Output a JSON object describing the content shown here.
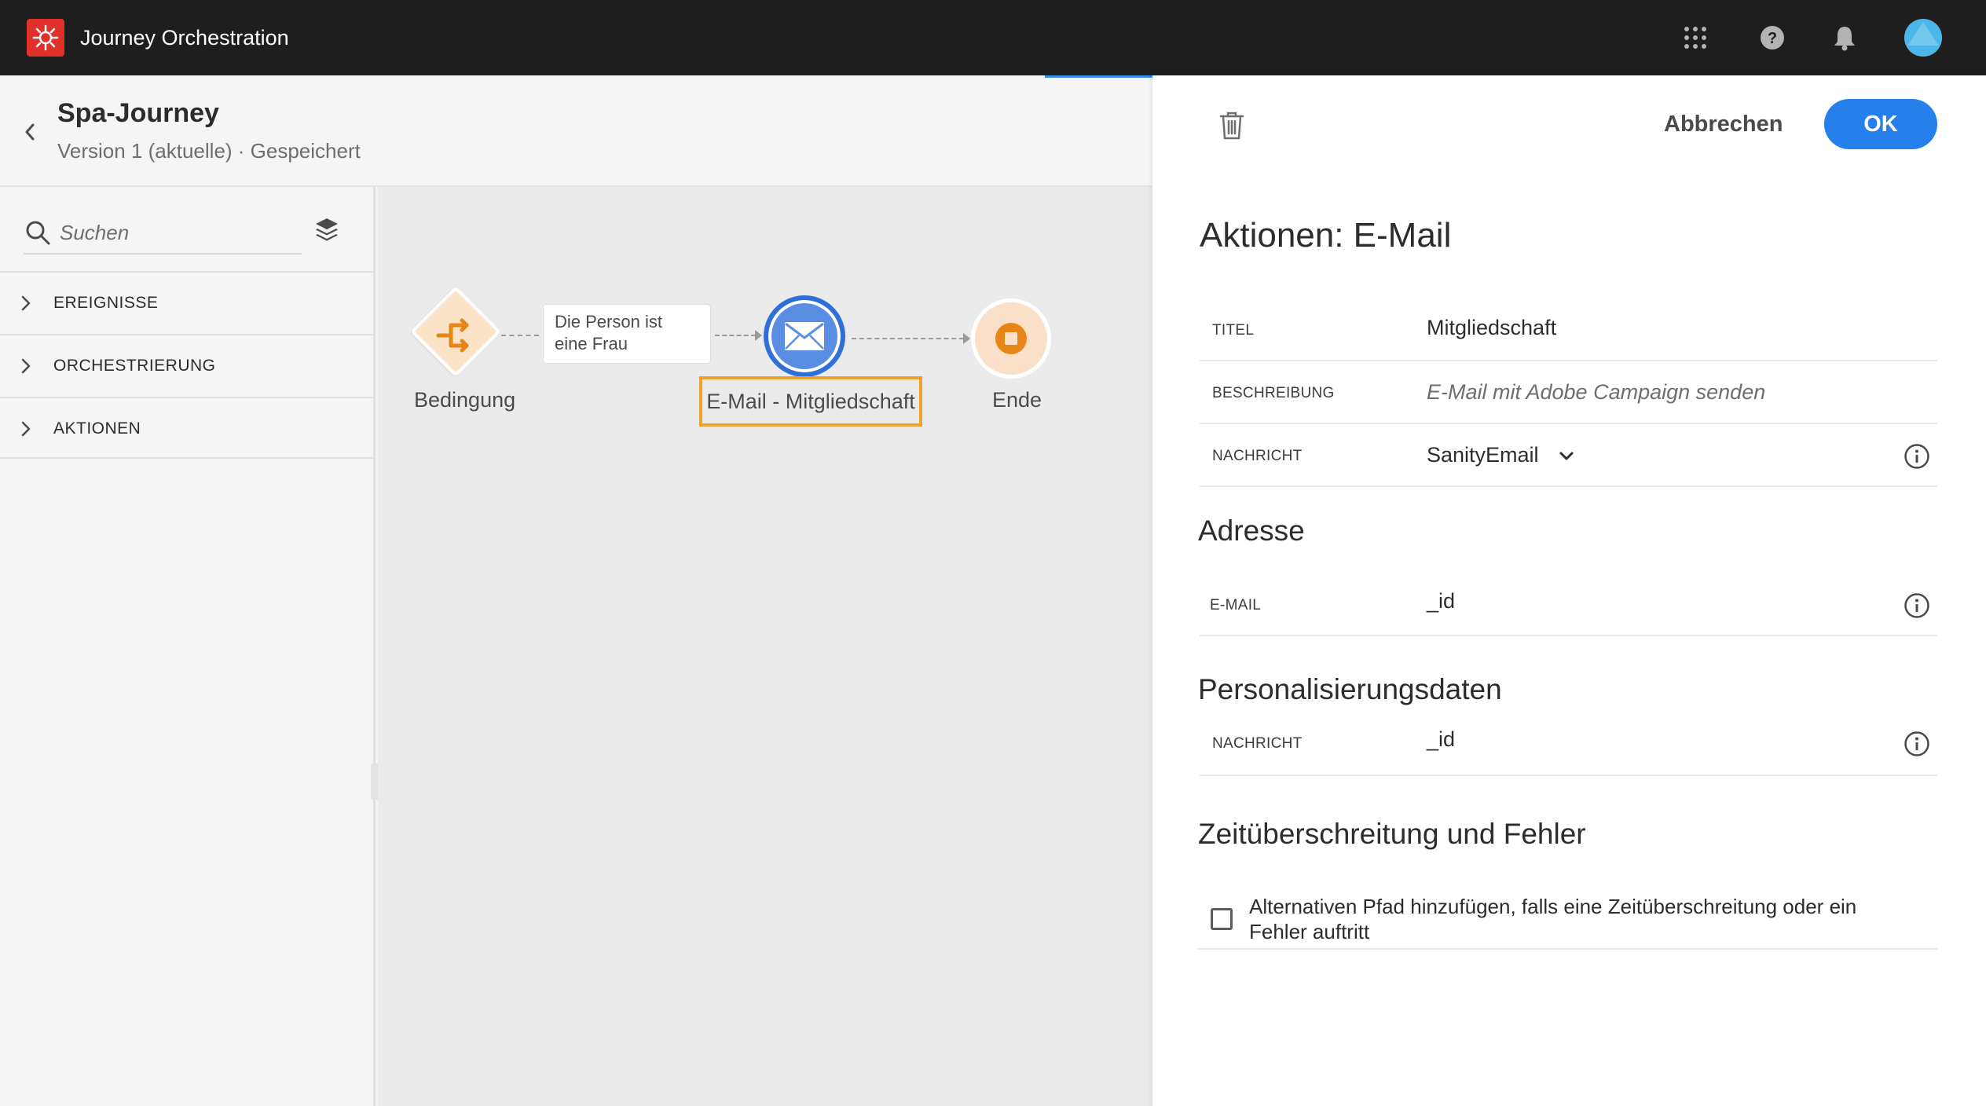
{
  "app": {
    "title": "Journey Orchestration"
  },
  "topbar_icons": [
    "apps-grid-icon",
    "help-icon",
    "bell-icon",
    "avatar"
  ],
  "journey": {
    "name": "Spa-Journey",
    "version": "Version 1 (aktuelle) · Gespeichert"
  },
  "sidebar": {
    "search_placeholder": "Suchen",
    "sections": [
      {
        "label": "EREIGNISSE"
      },
      {
        "label": "ORCHESTRIERUNG"
      },
      {
        "label": "AKTIONEN"
      }
    ]
  },
  "canvas": {
    "nodes": {
      "condition": {
        "label": "Bedingung"
      },
      "condition_path": {
        "label": "Die Person ist eine Frau"
      },
      "email": {
        "label": "E-Mail - Mitgliedschaft"
      },
      "end": {
        "label": "Ende"
      }
    }
  },
  "panel": {
    "cancel_label": "Abbrechen",
    "ok_label": "OK",
    "title": "Aktionen: E-Mail",
    "properties": {
      "title_key": "TITEL",
      "title_value": "Mitgliedschaft",
      "description_key": "BESCHREIBUNG",
      "description_placeholder": "E-Mail mit Adobe Campaign senden",
      "message_key": "NACHRICHT",
      "message_value": "SanityEmail"
    },
    "address": {
      "heading": "Adresse",
      "email_key": "E-MAIL",
      "email_value": "_id"
    },
    "personalization": {
      "heading": "Personalisierungsdaten",
      "message_key": "NACHRICHT",
      "message_value": "_id"
    },
    "timeout": {
      "heading": "Zeitüberschreitung und Fehler",
      "checkbox_label": "Alternativen Pfad hinzufügen, falls eine Zeitüberschreitung oder ein Fehler auftritt",
      "checked": false
    }
  },
  "colors": {
    "topbar": "#1e1e1e",
    "accent_blue": "#2680eb",
    "selection_orange": "#f0a22e",
    "condition_orange": "#e68619"
  }
}
